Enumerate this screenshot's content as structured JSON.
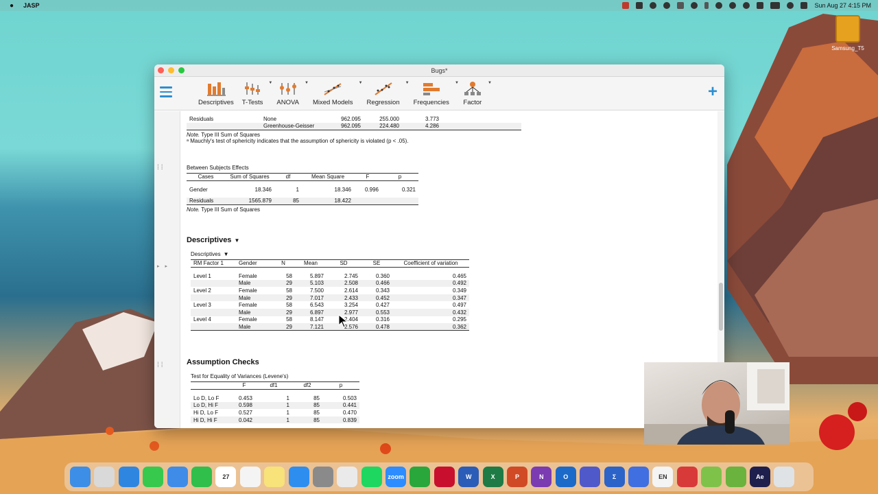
{
  "menubar": {
    "app_name": "JASP",
    "datetime": "Sun Aug 27  4:15 PM"
  },
  "desktop": {
    "drive_label": "Samsung_T5"
  },
  "window": {
    "title": "Bugs*",
    "toolbar": [
      {
        "label": "Descriptives",
        "icon": "descriptives-icon"
      },
      {
        "label": "T-Tests",
        "icon": "t-tests-icon"
      },
      {
        "label": "ANOVA",
        "icon": "anova-icon"
      },
      {
        "label": "Mixed Models",
        "icon": "mixed-models-icon"
      },
      {
        "label": "Regression",
        "icon": "regression-icon"
      },
      {
        "label": "Frequencies",
        "icon": "frequencies-icon"
      },
      {
        "label": "Factor",
        "icon": "factor-icon"
      }
    ]
  },
  "within_residuals": {
    "rows": [
      [
        "Residuals",
        "None",
        "962.095",
        "255.000",
        "3.773"
      ],
      [
        "",
        "Greenhouse-Geisser",
        "962.095",
        "224.480",
        "4.286"
      ]
    ],
    "note_label": "Note.",
    "note_text": "Type III Sum of Squares",
    "footnote": "ᵃ Mauchly's test of sphericity indicates that the assumption of sphericity is violated (p < .05)."
  },
  "between": {
    "title": "Between Subjects Effects",
    "headers": [
      "Cases",
      "Sum of Squares",
      "df",
      "Mean Square",
      "F",
      "p"
    ],
    "rows": [
      [
        "Gender",
        "18.346",
        "1",
        "18.346",
        "0.996",
        "0.321"
      ],
      [
        "Residuals",
        "1565.879",
        "85",
        "18.422",
        "",
        ""
      ]
    ],
    "note_label": "Note.",
    "note_text": "Type III Sum of Squares"
  },
  "descriptives": {
    "heading": "Descriptives",
    "subtitle": "Descriptives",
    "headers": [
      "RM Factor 1",
      "Gender",
      "N",
      "Mean",
      "SD",
      "SE",
      "Coefficient of variation"
    ],
    "rows": [
      [
        "Level 1",
        "Female",
        "58",
        "5.897",
        "2.745",
        "0.360",
        "0.465"
      ],
      [
        "",
        "Male",
        "29",
        "5.103",
        "2.508",
        "0.466",
        "0.492"
      ],
      [
        "Level 2",
        "Female",
        "58",
        "7.500",
        "2.614",
        "0.343",
        "0.349"
      ],
      [
        "",
        "Male",
        "29",
        "7.017",
        "2.433",
        "0.452",
        "0.347"
      ],
      [
        "Level 3",
        "Female",
        "58",
        "6.543",
        "3.254",
        "0.427",
        "0.497"
      ],
      [
        "",
        "Male",
        "29",
        "6.897",
        "2.977",
        "0.553",
        "0.432"
      ],
      [
        "Level 4",
        "Female",
        "58",
        "8.147",
        "2.404",
        "0.316",
        "0.295"
      ],
      [
        "",
        "Male",
        "29",
        "7.121",
        "2.576",
        "0.478",
        "0.362"
      ]
    ]
  },
  "assumption": {
    "heading": "Assumption Checks",
    "subtitle": "Test for Equality of Variances (Levene's)",
    "headers": [
      "",
      "F",
      "df1",
      "df2",
      "p"
    ],
    "rows": [
      [
        "Lo D, Lo F",
        "0.453",
        "1",
        "85",
        "0.503"
      ],
      [
        "Lo D, Hi F",
        "0.598",
        "1",
        "85",
        "0.441"
      ],
      [
        "Hi D, Lo F",
        "0.527",
        "1",
        "85",
        "0.470"
      ],
      [
        "Hi D, Hi F",
        "0.042",
        "1",
        "85",
        "0.839"
      ]
    ]
  },
  "dock": [
    {
      "name": "finder-icon",
      "color": "#3d8ee6",
      "label": ""
    },
    {
      "name": "launchpad-icon",
      "color": "#d9d9d9",
      "label": ""
    },
    {
      "name": "safari-icon",
      "color": "#2f86e0",
      "label": ""
    },
    {
      "name": "messages-icon",
      "color": "#36c94e",
      "label": ""
    },
    {
      "name": "mail-icon",
      "color": "#3f8ce8",
      "label": ""
    },
    {
      "name": "facetime-icon",
      "color": "#2fbf4a",
      "label": ""
    },
    {
      "name": "calendar-icon",
      "color": "#ffffff",
      "label": "27"
    },
    {
      "name": "reminders-icon",
      "color": "#f4f4f4",
      "label": ""
    },
    {
      "name": "notes-icon",
      "color": "#f8e27a",
      "label": ""
    },
    {
      "name": "app-store-icon",
      "color": "#2d8ef0",
      "label": ""
    },
    {
      "name": "system-settings-icon",
      "color": "#8a8a8a",
      "label": ""
    },
    {
      "name": "chrome-icon",
      "color": "#eaeaea",
      "label": ""
    },
    {
      "name": "spotify-icon",
      "color": "#1ed760",
      "label": ""
    },
    {
      "name": "zoom-icon",
      "color": "#2d8cff",
      "label": "zoom"
    },
    {
      "name": "camtasia-icon",
      "color": "#29a73b",
      "label": ""
    },
    {
      "name": "acrobat-icon",
      "color": "#c8102e",
      "label": ""
    },
    {
      "name": "word-icon",
      "color": "#2b5cb8",
      "label": "W"
    },
    {
      "name": "excel-icon",
      "color": "#1e7b45",
      "label": "X"
    },
    {
      "name": "powerpoint-icon",
      "color": "#d04a26",
      "label": "P"
    },
    {
      "name": "onenote-icon",
      "color": "#7b3bb1",
      "label": "N"
    },
    {
      "name": "outlook-icon",
      "color": "#1b6ac9",
      "label": "O"
    },
    {
      "name": "teams-icon",
      "color": "#5059c9",
      "label": ""
    },
    {
      "name": "calculator-icon",
      "color": "#2b63c9",
      "label": "Σ"
    },
    {
      "name": "spreadsheet-icon",
      "color": "#3f6fe0",
      "label": ""
    },
    {
      "name": "keyboard-icon",
      "color": "#f4f4f4",
      "label": "EN"
    },
    {
      "name": "parallels-icon",
      "color": "#d83a3a",
      "label": ""
    },
    {
      "name": "jasp-icon",
      "color": "#7fc24a",
      "label": ""
    },
    {
      "name": "jasp2-icon",
      "color": "#69b33e",
      "label": ""
    },
    {
      "name": "after-effects-icon",
      "color": "#1f1f4d",
      "label": "Ae"
    },
    {
      "name": "trash-icon",
      "color": "#dfe3e6",
      "label": ""
    }
  ]
}
